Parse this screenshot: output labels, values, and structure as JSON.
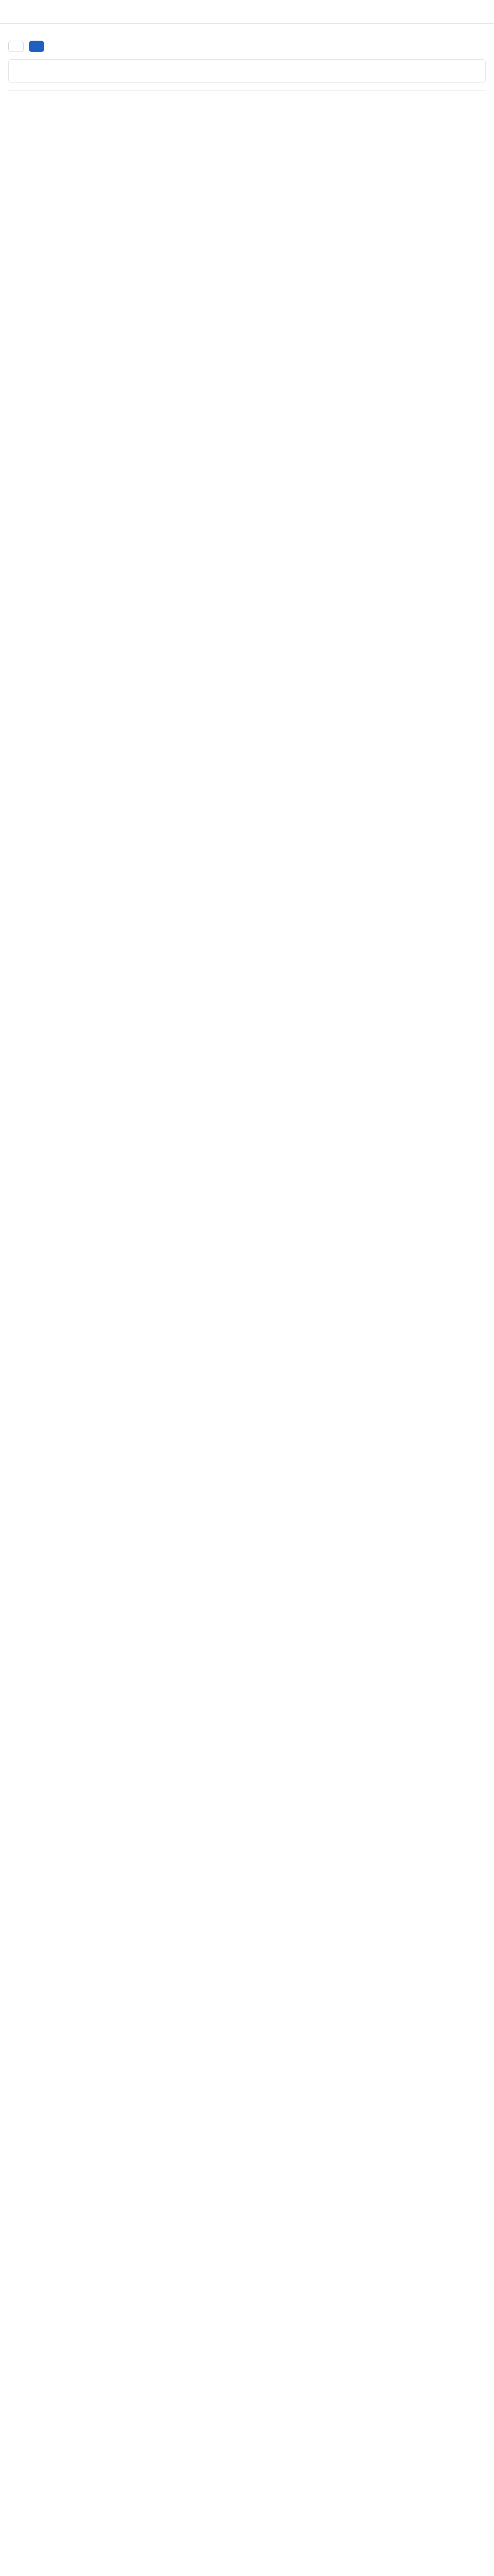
{
  "app": {
    "name": ""
  },
  "nav": {
    "items": []
  },
  "tabs": {
    "items": []
  },
  "header": {
    "title": "",
    "subtitle": ""
  },
  "actions": {
    "apply_label": "",
    "save_label": ""
  },
  "sections": [
    {
      "title": "",
      "fields": []
    }
  ],
  "footer": {
    "text": ""
  }
}
